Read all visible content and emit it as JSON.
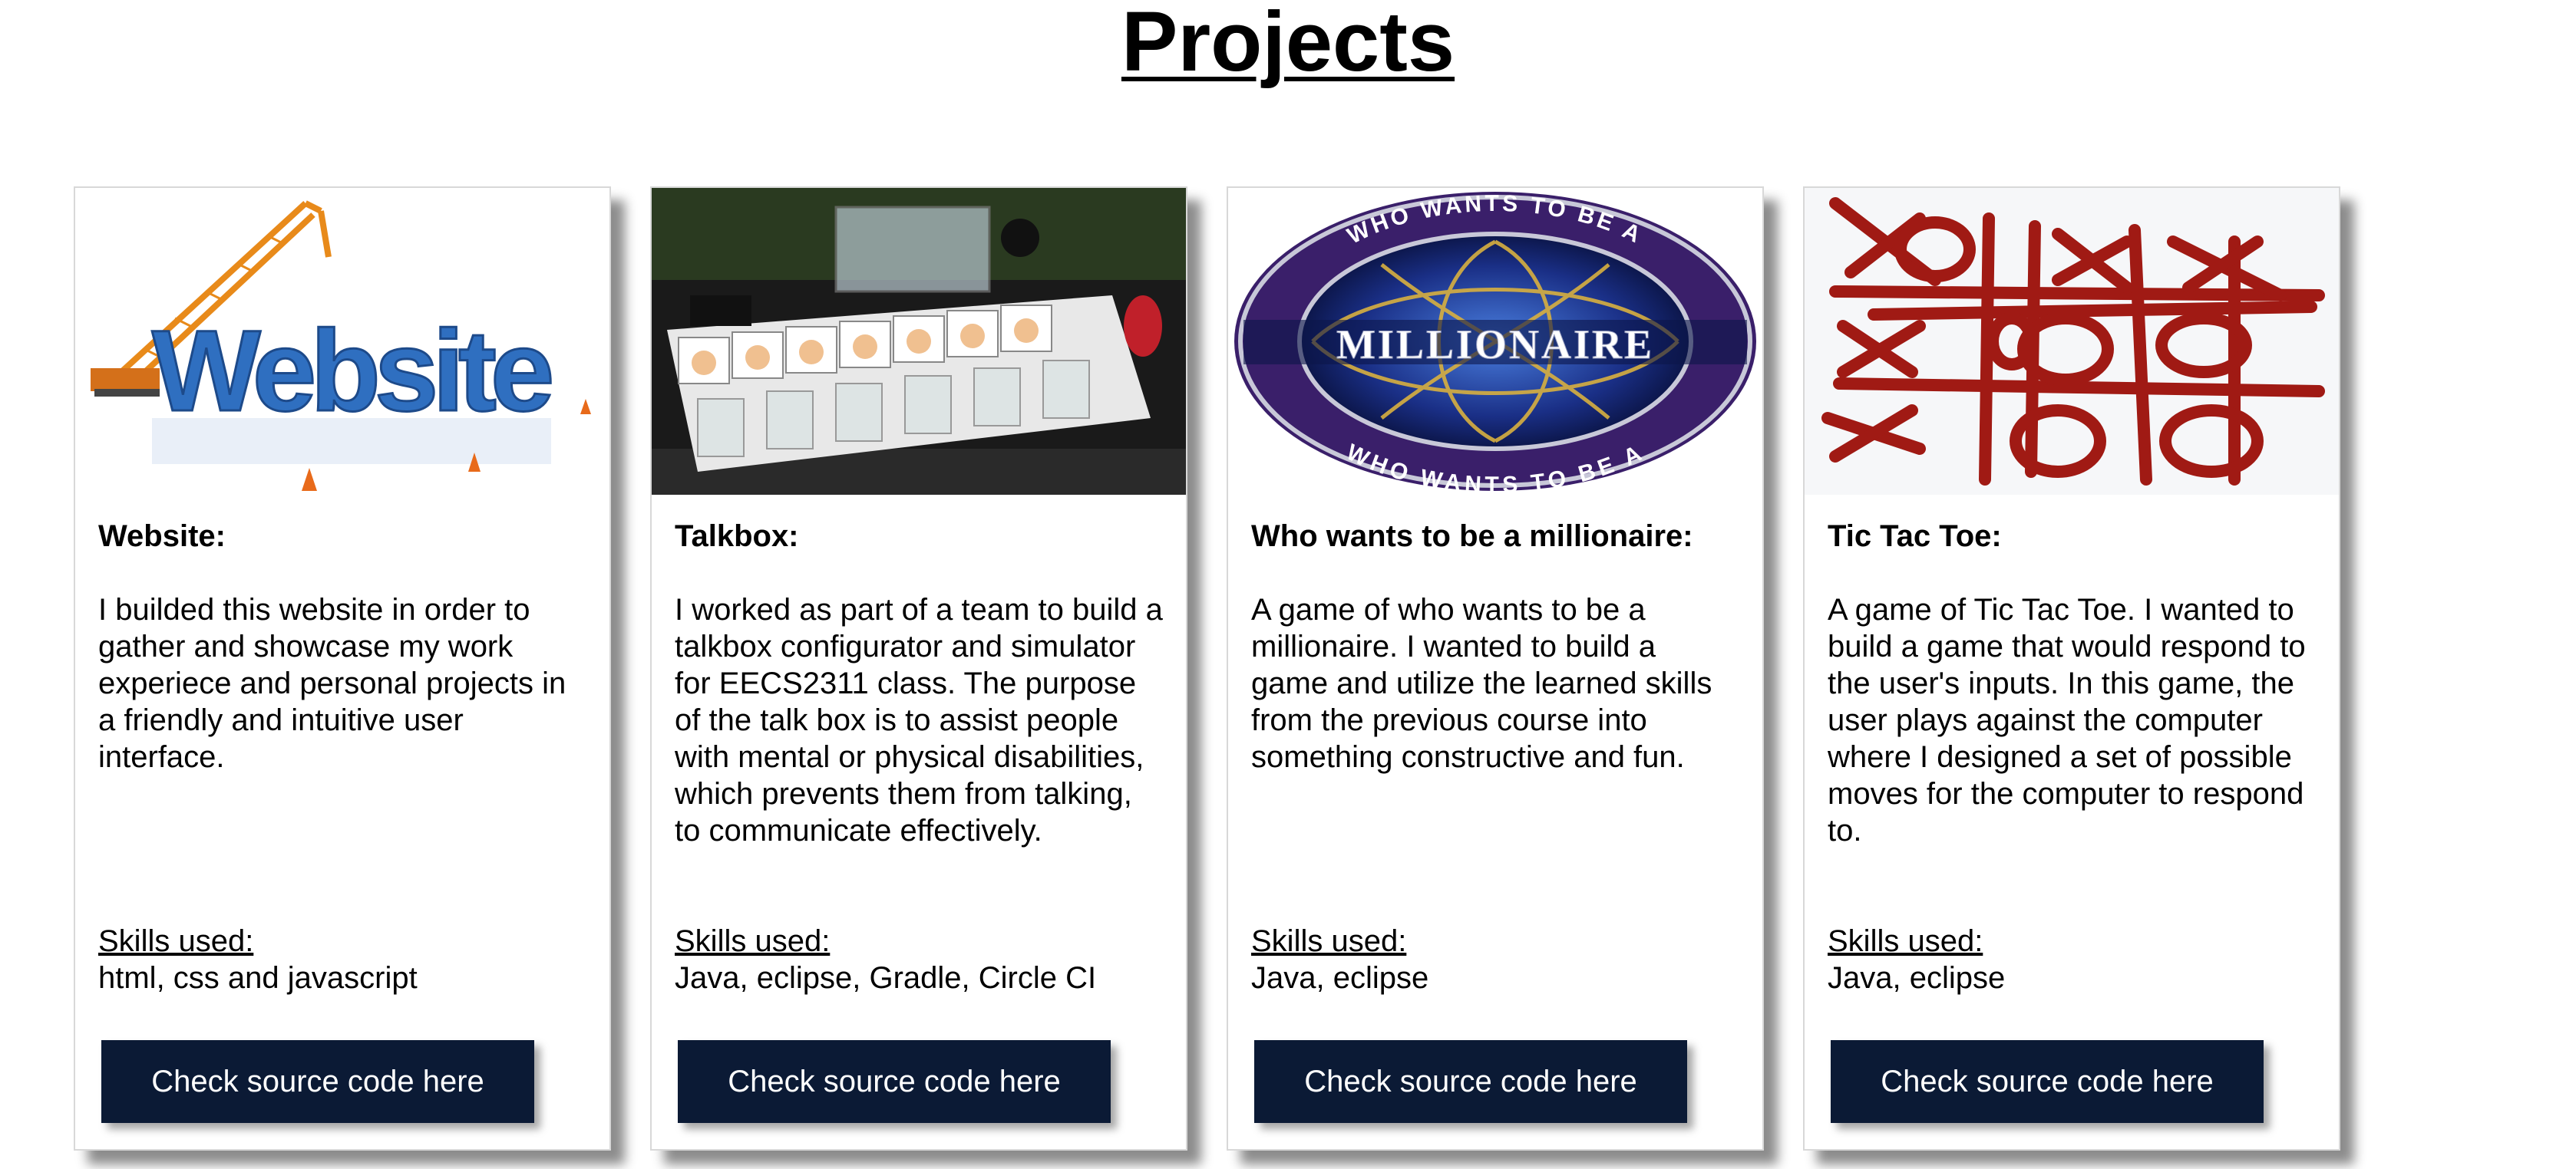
{
  "page": {
    "title": "Projects"
  },
  "projects": [
    {
      "title": "Website:",
      "image": "website-construction-image",
      "image_text": "Website",
      "description": "I builded this website in order to gather and showcase my work experiece and personal projects in a friendly and intuitive user interface.",
      "skills_label": "Skills used:",
      "skills": "html, css and javascript",
      "button_label": "Check source code here"
    },
    {
      "title": "Talkbox:",
      "image": "talkbox-device-photo",
      "description": "I worked as part of a team to build a talkbox configurator and simulator for EECS2311 class. The purpose of the talk box is to assist people with mental or physical disabilities, which prevents them from talking, to communicate effectively.",
      "skills_label": "Skills used:",
      "skills": "Java, eclipse, Gradle, Circle CI",
      "button_label": "Check source code here"
    },
    {
      "title": "Who wants to be a millionaire:",
      "image": "millionaire-logo-image",
      "image_text": "MILLIONAIRE",
      "image_ring_text": "WHO WANTS TO BE A",
      "description": "A game of who wants to be a millionaire. I wanted to build a game and utilize the learned skills from the previous course into something constructive and fun.",
      "skills_label": "Skills used:",
      "skills": "Java, eclipse",
      "button_label": "Check source code here"
    },
    {
      "title": "Tic Tac Toe:",
      "image": "tic-tac-toe-image",
      "description": "A game of Tic Tac Toe. I wanted to build a game that would respond to the user's inputs. In this game, the user plays against the computer where I designed a set of possible moves for the computer to respond to.",
      "skills_label": "Skills used:",
      "skills": "Java, eclipse",
      "button_label": "Check source code here"
    }
  ],
  "colors": {
    "button_bg": "#0b1a35",
    "website_blue": "#2f6fc0",
    "crane_orange": "#e88a1a",
    "millionaire_blue": "#1a2f86",
    "tictactoe_red": "#a01a14"
  }
}
